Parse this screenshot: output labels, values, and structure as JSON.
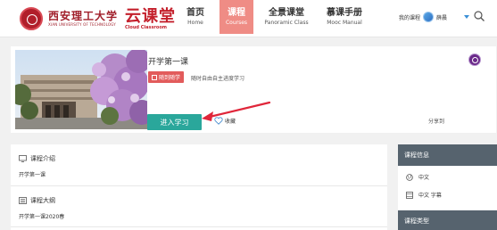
{
  "header": {
    "logo_school_cn": "西安理工大学",
    "logo_school_en": "XIAN UNIVERSITY OF TECHNOLOGY",
    "logo_yun_cn": "云课堂",
    "logo_yun_en": "Cloud Classroom",
    "nav": [
      {
        "cn": "首页",
        "en": "Home"
      },
      {
        "cn": "课程",
        "en": "Courses"
      },
      {
        "cn": "全景课堂",
        "en": "Panoramic Class"
      },
      {
        "cn": "慕课手册",
        "en": "Mooc Manual"
      }
    ],
    "my_courses": "我的课程",
    "user_name": "薛晨"
  },
  "course": {
    "title": "开学第一课",
    "tag": "随到随学",
    "tag_note": "随时自由自主进度学习",
    "enter_label": "进入学习",
    "collect_label": "收藏",
    "share_label": "分享到"
  },
  "main": {
    "intro_title": "课程介绍",
    "intro_text": "开学第一课",
    "outline_title": "课程大纲",
    "outline_text": "开学第一课2020春"
  },
  "sidebar": {
    "info_title": "课程信息",
    "language": "中文",
    "subtitle": "中文 字幕",
    "type_title": "课程类型"
  },
  "colors": {
    "nav_active": "#ef8c85",
    "enter_button": "#2aa79b",
    "tag": "#e25b5b",
    "sidebar_head": "#56636e",
    "arrow": "#e0263a"
  }
}
